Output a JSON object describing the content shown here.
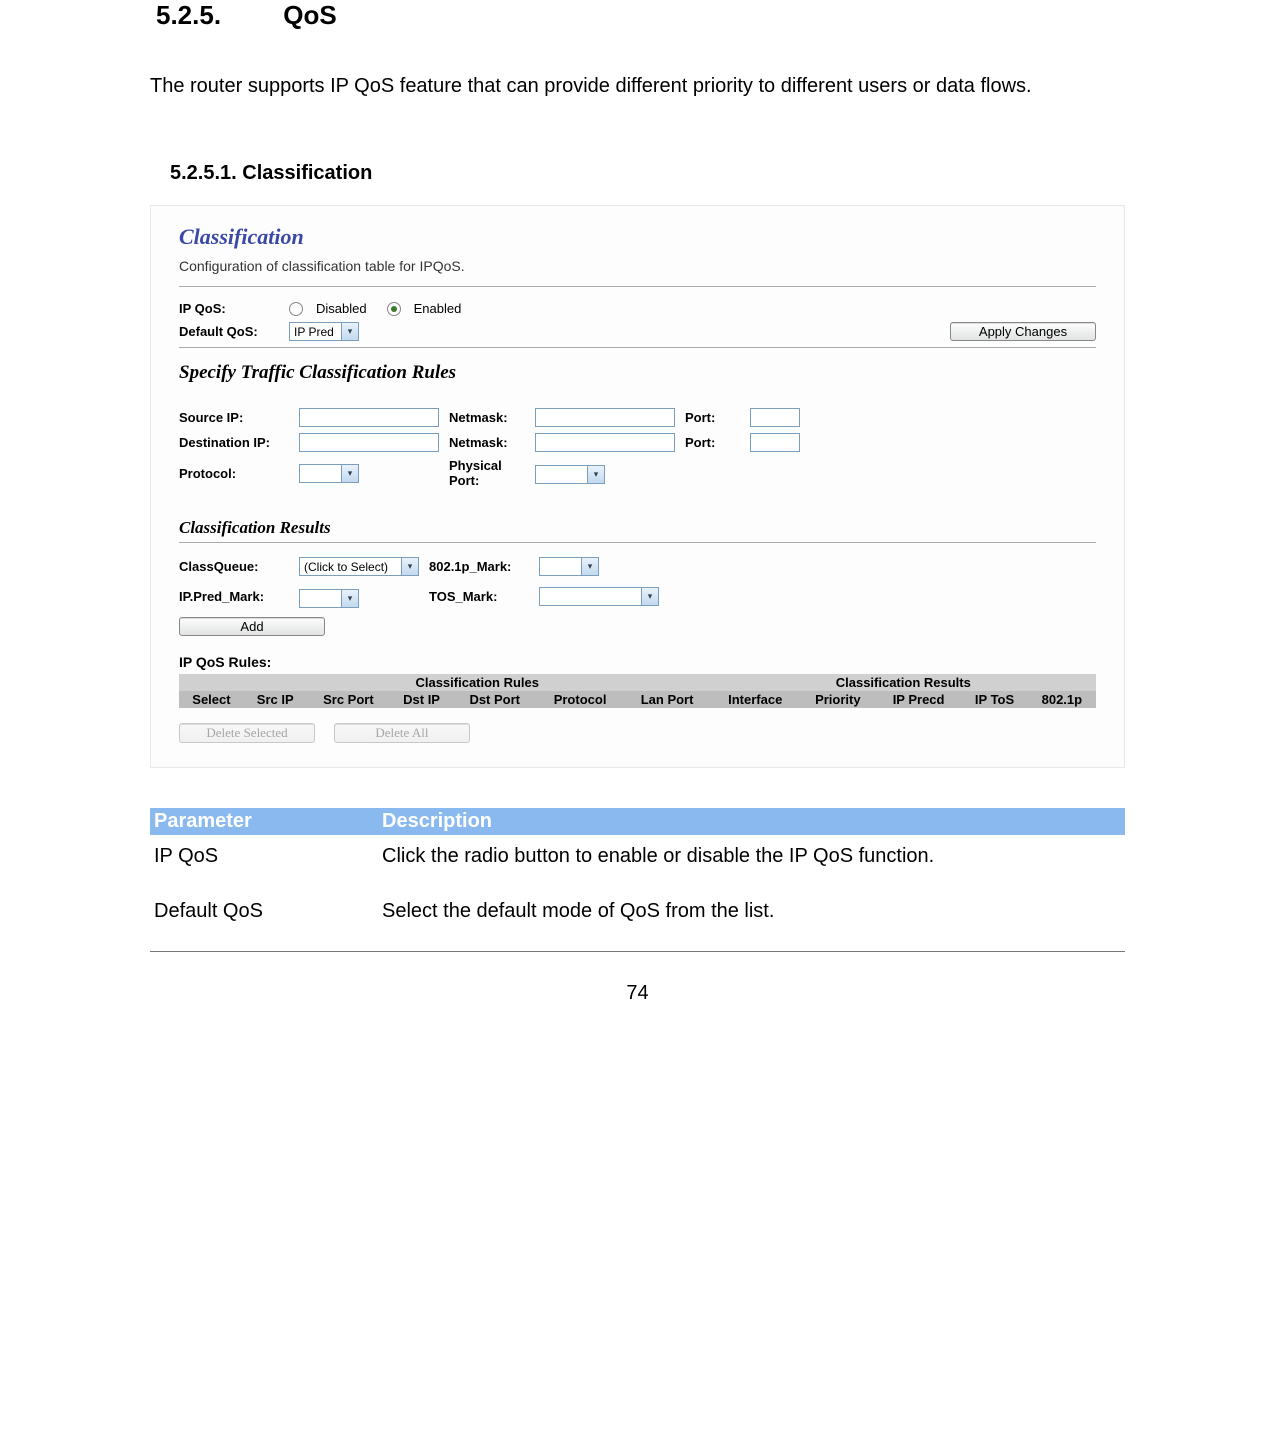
{
  "headings": {
    "h525_num": "5.2.5.",
    "h525_title": "QoS",
    "intro": "The router supports IP QoS feature that can provide different priority to different users or data flows.",
    "h5251": "5.2.5.1. Classification"
  },
  "screenshot": {
    "title": "Classification",
    "desc": "Configuration of classification table for IPQoS.",
    "ipqos_label": "IP QoS:",
    "disabled_label": "Disabled",
    "enabled_label": "Enabled",
    "defaultqos_label": "Default QoS:",
    "defaultqos_value": "IP Pred",
    "apply_btn": "Apply Changes",
    "rules_heading": "Specify Traffic Classification Rules",
    "src_ip": "Source IP:",
    "netmask": "Netmask:",
    "port": "Port:",
    "dst_ip": "Destination IP:",
    "protocol": "Protocol:",
    "phys_port": "Physical Port:",
    "results_heading": "Classification Results",
    "classqueue": "ClassQueue:",
    "classqueue_val": "(Click to Select)",
    "mark8021p": "802.1p_Mark:",
    "ippred": "IP.Pred_Mark:",
    "tosmark": "TOS_Mark:",
    "add_btn": "Add",
    "rules_lbl": "IP QoS Rules:",
    "group_rules": "Classification Rules",
    "group_results": "Classification Results",
    "cols": {
      "select": "Select",
      "srcip": "Src IP",
      "srcport": "Src Port",
      "dstip": "Dst IP",
      "dstport": "Dst Port",
      "protocol": "Protocol",
      "lanport": "Lan Port",
      "interface": "Interface",
      "priority": "Priority",
      "ipprecd": "IP Precd",
      "iptos": "IP ToS",
      "p8021p": "802.1p"
    },
    "delete_selected": "Delete Selected",
    "delete_all": "Delete All"
  },
  "param_table": {
    "head_param": "Parameter",
    "head_desc": "Description",
    "rows": [
      {
        "param": "IP QoS",
        "desc": "Click the radio button to enable or disable the IP QoS function."
      },
      {
        "param": "Default QoS",
        "desc": "Select the default mode of QoS from the list."
      }
    ]
  },
  "page_number": "74"
}
